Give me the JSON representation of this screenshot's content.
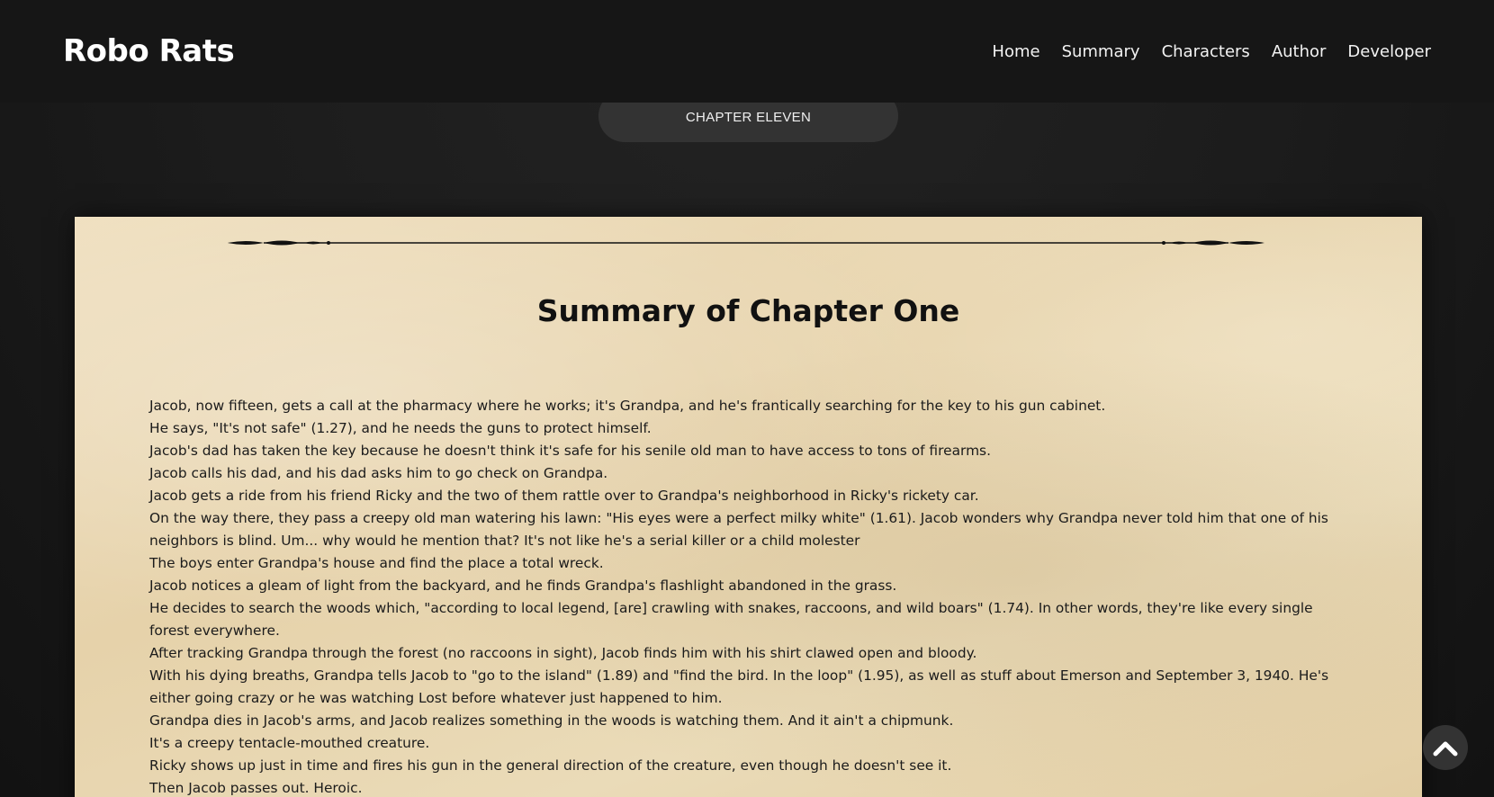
{
  "header": {
    "brand": "Robo Rats",
    "nav": [
      "Home",
      "Summary",
      "Characters",
      "Author",
      "Developer"
    ]
  },
  "chapter_selector": {
    "label": "CHAPTER ELEVEN"
  },
  "summary": {
    "title": "Summary of Chapter One",
    "paragraphs": [
      "Jacob, now fifteen, gets a call at the pharmacy where he works; it's Grandpa, and he's frantically searching for the key to his gun cabinet.",
      "He says, \"It's not safe\" (1.27), and he needs the guns to protect himself.",
      "Jacob's dad has taken the key because he doesn't think it's safe for his senile old man to have access to tons of firearms.",
      "Jacob calls his dad, and his dad asks him to go check on Grandpa.",
      "Jacob gets a ride from his friend Ricky and the two of them rattle over to Grandpa's neighborhood in Ricky's rickety car.",
      "On the way there, they pass a creepy old man watering his lawn: \"His eyes were a perfect milky white\" (1.61). Jacob wonders why Grandpa never told him that one of his neighbors is blind. Um... why would he mention that? It's not like he's a serial killer or a child molester",
      "The boys enter Grandpa's house and find the place a total wreck.",
      "Jacob notices a gleam of light from the backyard, and he finds Grandpa's flashlight abandoned in the grass.",
      "He decides to search the woods which, \"according to local legend, [are] crawling with snakes, raccoons, and wild boars\" (1.74). In other words, they're like every single forest everywhere.",
      "After tracking Grandpa through the forest (no raccoons in sight), Jacob finds him with his shirt clawed open and bloody.",
      "With his dying breaths, Grandpa tells Jacob to \"go to the island\" (1.89) and \"find the bird. In the loop\" (1.95), as well as stuff about Emerson and September 3, 1940. He's either going crazy or he was watching Lost before whatever just happened to him.",
      "Grandpa dies in Jacob's arms, and Jacob realizes something in the woods is watching them. And it ain't a chipmunk.",
      "It's a creepy tentacle-mouthed creature.",
      "Ricky shows up just in time and fires his gun in the general direction of the creature, even though he doesn't see it.",
      "Then Jacob passes out. Heroic."
    ]
  },
  "scroll_top": {
    "icon": "chevron-up-icon"
  },
  "colors": {
    "navbar": "#161616",
    "pill": "#333333",
    "paper": "#e9d8b3",
    "text": "#1b1b1b"
  }
}
